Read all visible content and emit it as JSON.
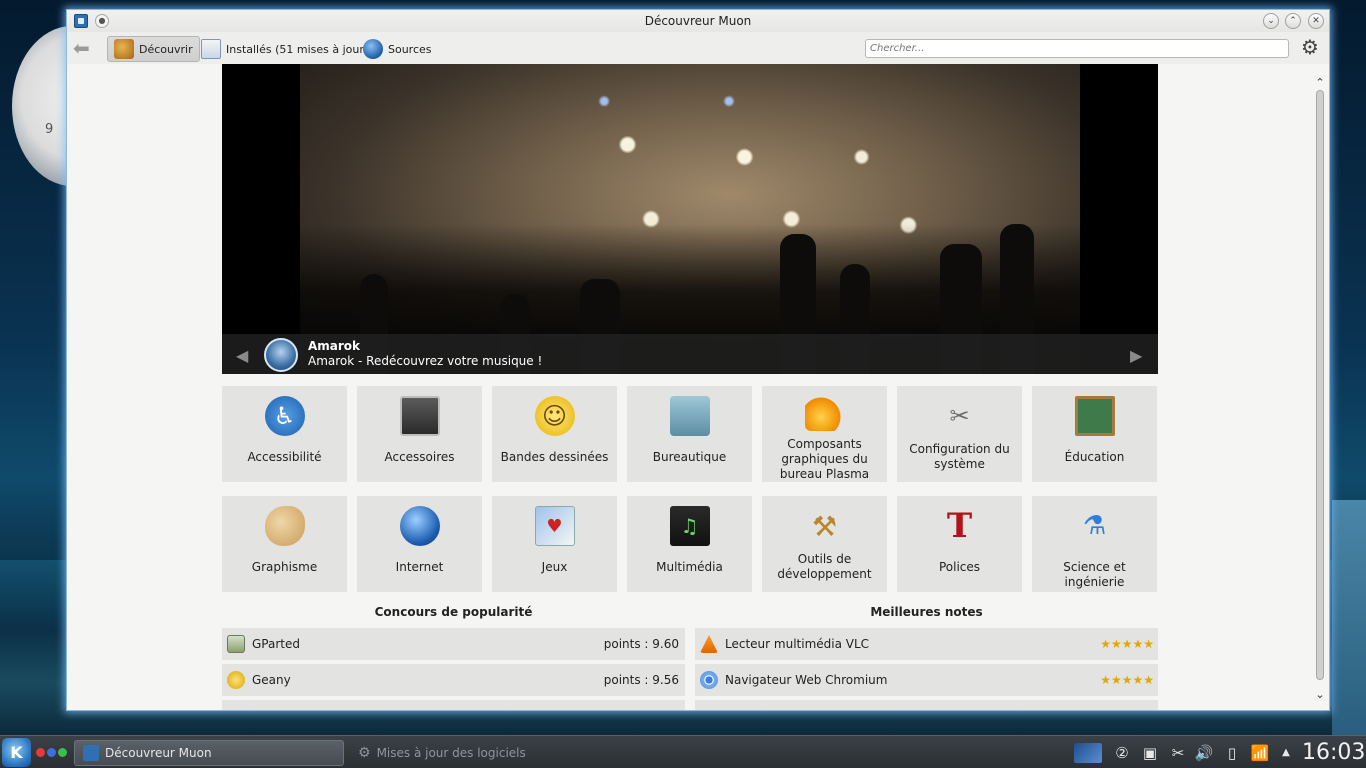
{
  "window": {
    "title": "Découvreur Muon"
  },
  "toolbar": {
    "discover_label": "Découvrir",
    "installed_label": "Installés (51 mises à jour)",
    "sources_label": "Sources",
    "search_placeholder": "Chercher..."
  },
  "banner": {
    "app_name": "Amarok",
    "description": "Amarok - Redécouvrez votre musique !"
  },
  "categories": [
    {
      "label": "Accessibilité",
      "icon": "accessibility-icon"
    },
    {
      "label": "Accessoires",
      "icon": "accessories-icon"
    },
    {
      "label": "Bandes dessinées",
      "icon": "comics-icon"
    },
    {
      "label": "Bureautique",
      "icon": "office-typewriter-icon"
    },
    {
      "label": "Composants graphiques du bureau Plasma",
      "icon": "plasma-icon"
    },
    {
      "label": "Configuration du système",
      "icon": "system-tools-icon"
    },
    {
      "label": "Éducation",
      "icon": "education-icon"
    },
    {
      "label": "Graphisme",
      "icon": "graphics-palette-icon"
    },
    {
      "label": "Internet",
      "icon": "internet-globe-icon"
    },
    {
      "label": "Jeux",
      "icon": "games-cards-icon"
    },
    {
      "label": "Multimédia",
      "icon": "multimedia-icon"
    },
    {
      "label": "Outils de développement",
      "icon": "development-hammer-icon"
    },
    {
      "label": "Polices",
      "icon": "fonts-icon"
    },
    {
      "label": "Science et ingénierie",
      "icon": "science-flask-icon"
    }
  ],
  "popularity": {
    "title": "Concours de popularité",
    "items": [
      {
        "name": "GParted",
        "score": "points : 9.60"
      },
      {
        "name": "Geany",
        "score": "points : 9.56"
      }
    ]
  },
  "top_rated": {
    "title": "Meilleures notes",
    "items": [
      {
        "name": "Lecteur multimédia VLC",
        "rating": "★★★★★"
      },
      {
        "name": "Navigateur Web Chromium",
        "rating": "★★★★★"
      }
    ]
  },
  "desktop": {
    "clock_widget_number": "9"
  },
  "taskbar": {
    "task_active": "Découvreur Muon",
    "task_inactive": "Mises à jour des logiciels",
    "clock": "16:03"
  },
  "colors": {
    "accent": "#2f6fb2",
    "tile_bg": "#e3e3e2",
    "star": "#e0a800"
  }
}
